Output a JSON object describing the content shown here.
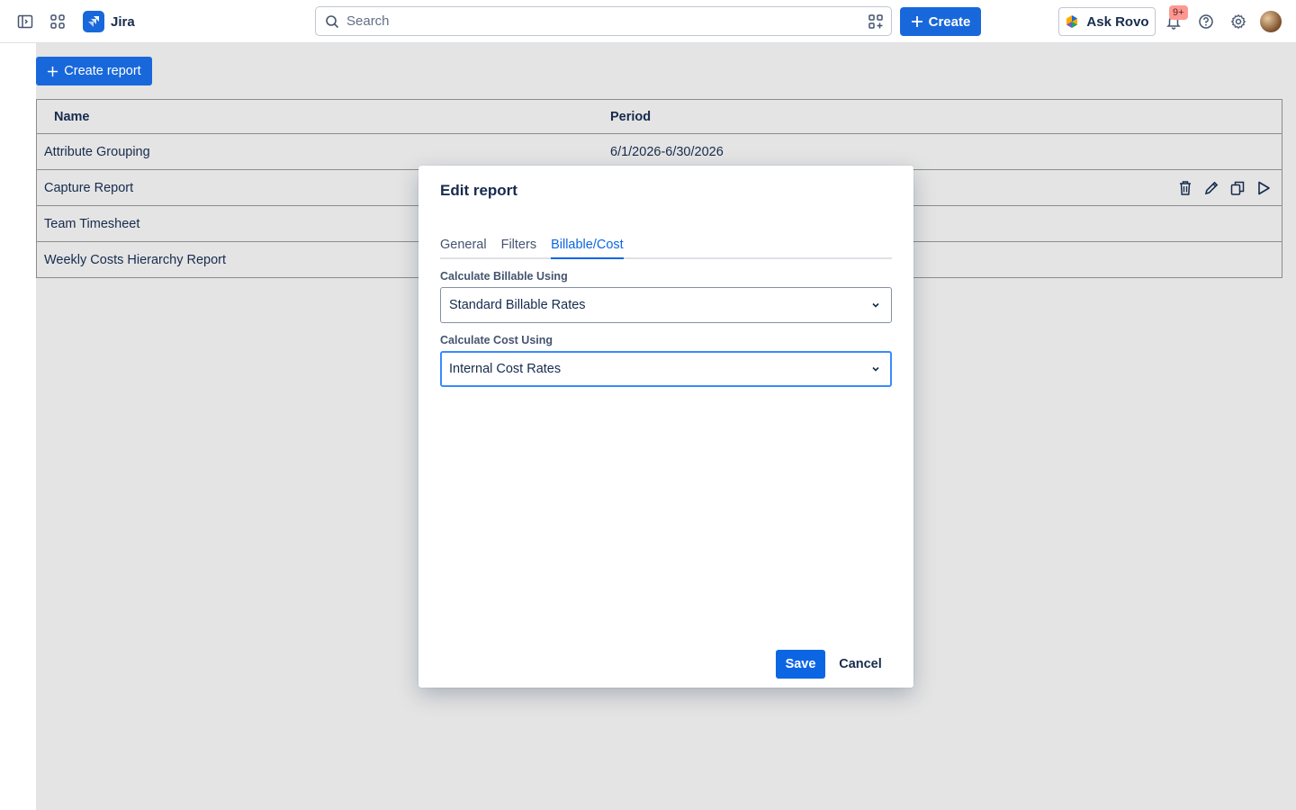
{
  "topbar": {
    "app_name": "Jira",
    "search_placeholder": "Search",
    "create_label": "Create",
    "ask_rovo_label": "Ask Rovo",
    "notifications_badge": "9+",
    "icons": [
      "sidebar-toggle-icon",
      "app-switcher-icon",
      "jira-logo-icon",
      "search-icon",
      "search-filter-icon",
      "plus-icon",
      "rovo-icon",
      "bell-icon",
      "help-icon",
      "gear-icon"
    ],
    "brand_color": "#1868db"
  },
  "main": {
    "create_report_label": "Create report",
    "table": {
      "headers": [
        "Name",
        "Period"
      ],
      "rows": [
        {
          "name": "Attribute Grouping",
          "period": "6/1/2026-6/30/2026"
        },
        {
          "name": "Capture Report",
          "period": ""
        },
        {
          "name": "Team Timesheet",
          "period": ""
        },
        {
          "name": "Weekly Costs Hierarchy Report",
          "period": ""
        }
      ],
      "row_actions": [
        "trash-icon",
        "pencil-icon",
        "copy-icon",
        "play-icon"
      ]
    }
  },
  "modal": {
    "title": "Edit report",
    "tabs": [
      {
        "label": "General",
        "active": false
      },
      {
        "label": "Filters",
        "active": false
      },
      {
        "label": "Billable/Cost",
        "active": true
      }
    ],
    "billable_label": "Calculate Billable Using",
    "billable_value": "Standard Billable Rates",
    "cost_label": "Calculate Cost Using",
    "cost_value": "Internal Cost Rates",
    "save_label": "Save",
    "cancel_label": "Cancel"
  }
}
